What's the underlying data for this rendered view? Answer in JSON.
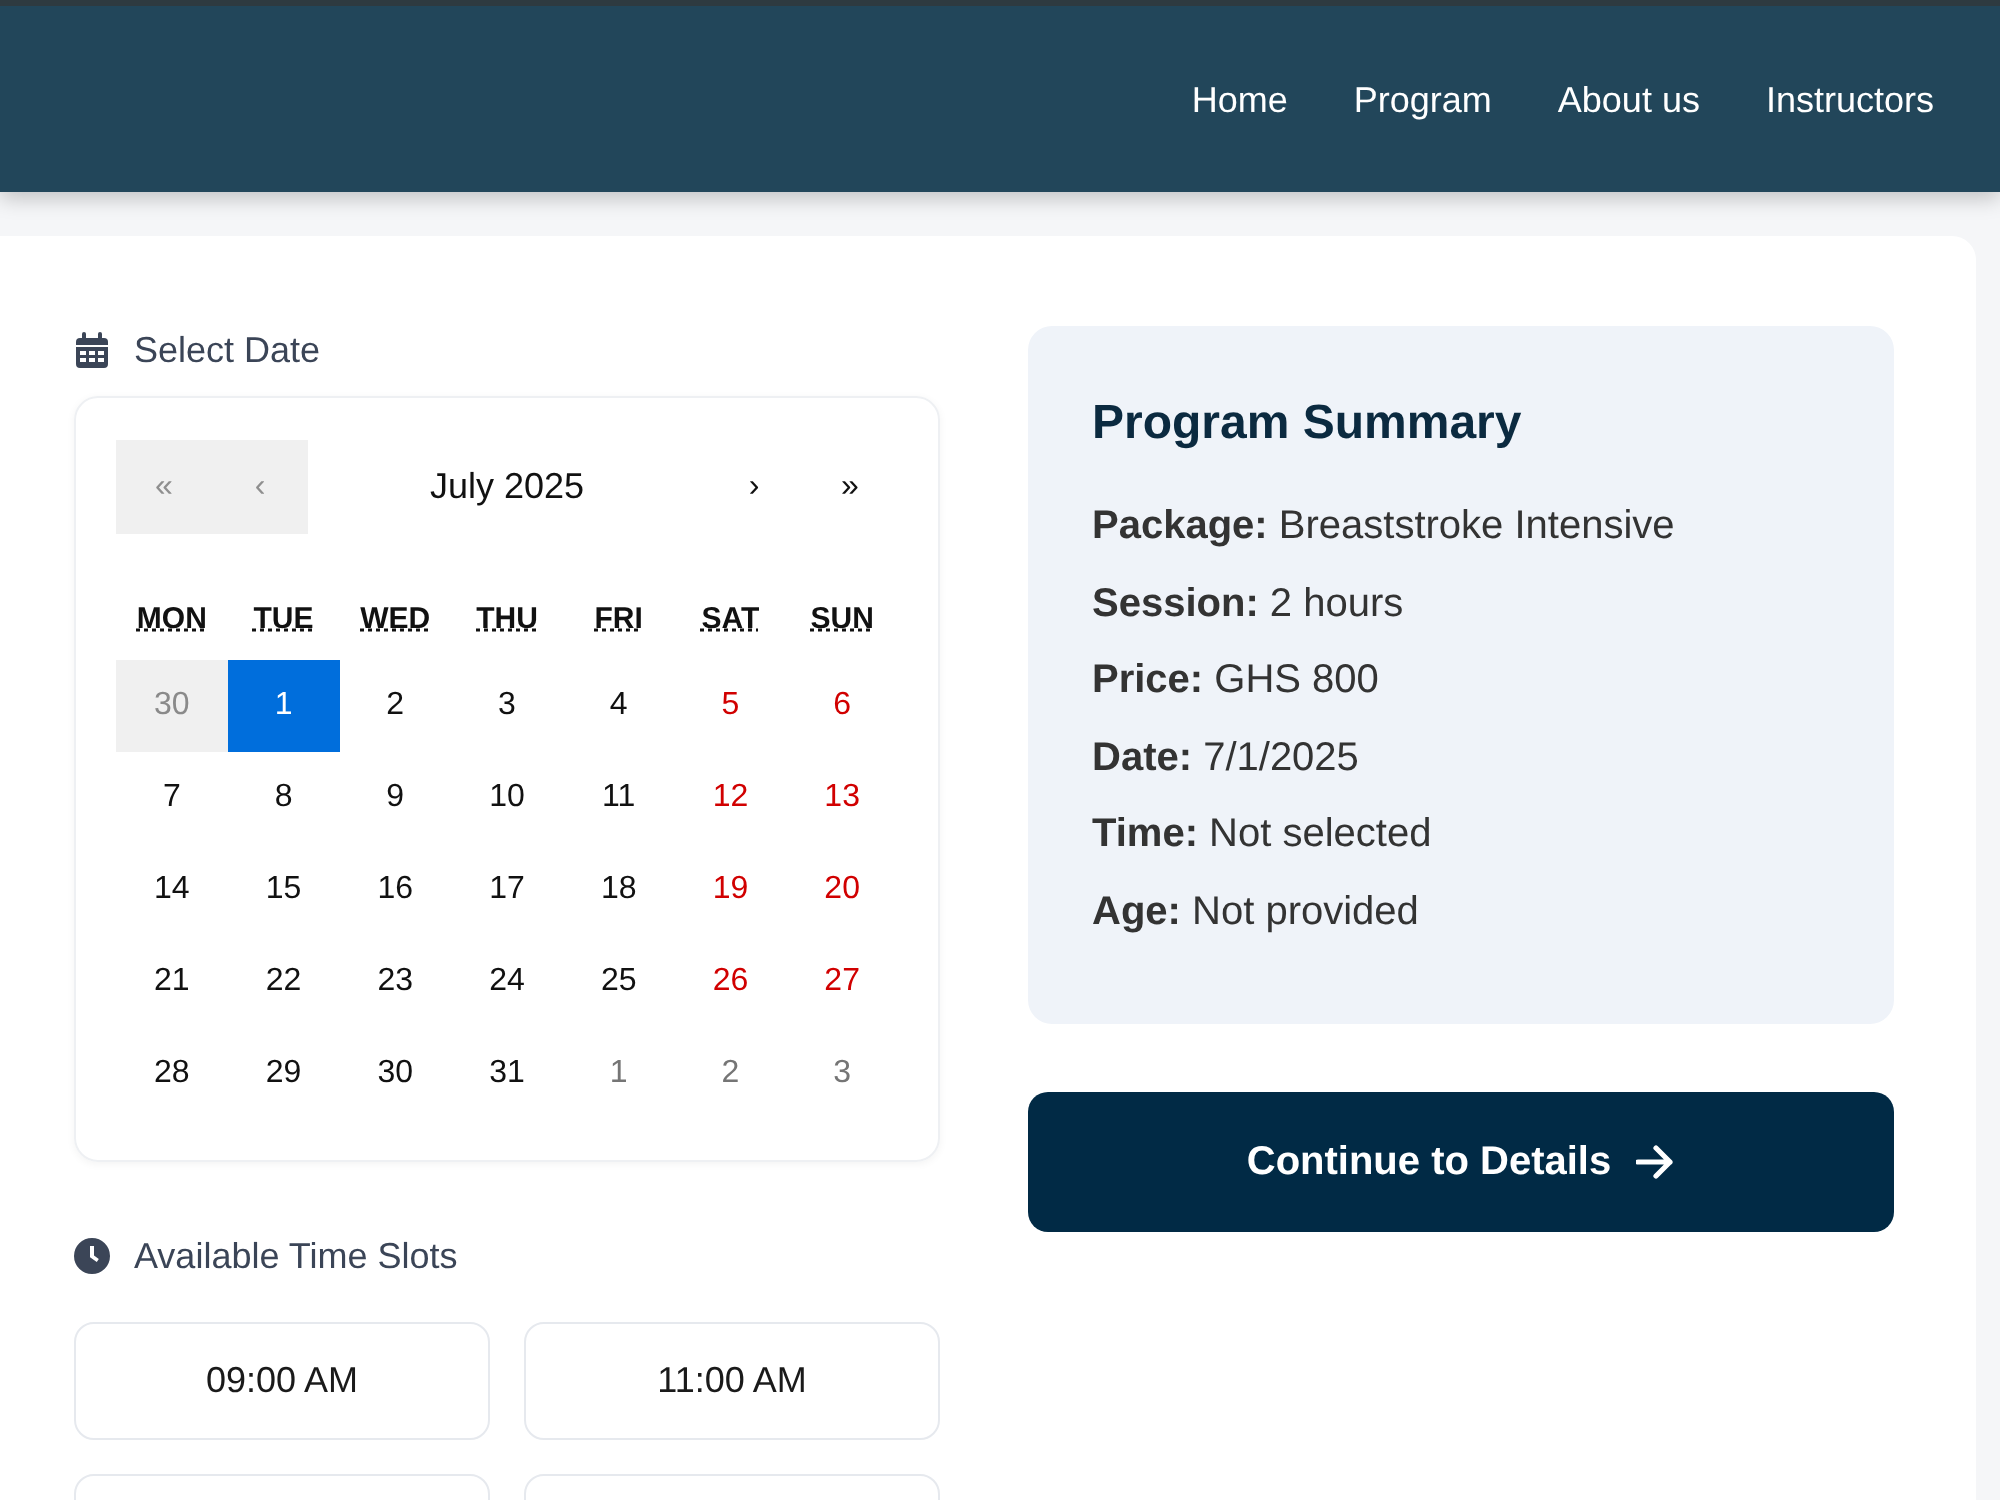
{
  "header": {
    "nav_links": [
      "Home",
      "Program",
      "About us",
      "Instructors"
    ]
  },
  "date_picker": {
    "heading": "Select Date",
    "calendar": {
      "prev_buttons": [
        {
          "label": "«",
          "disabled": true
        },
        {
          "label": "‹",
          "disabled": true
        }
      ],
      "month_label": "July 2025",
      "next_buttons": [
        {
          "label": "›",
          "disabled": false
        },
        {
          "label": "»",
          "disabled": false
        }
      ],
      "weekdays": [
        "MON",
        "TUE",
        "WED",
        "THU",
        "FRI",
        "SAT",
        "SUN"
      ],
      "weeks": [
        {
          "days": [
            {
              "label": "30",
              "kind": "disabled",
              "selected": false
            },
            {
              "label": "1",
              "kind": "day",
              "selected": true
            },
            {
              "label": "2",
              "kind": "day",
              "selected": false
            },
            {
              "label": "3",
              "kind": "day",
              "selected": false
            },
            {
              "label": "4",
              "kind": "day",
              "selected": false
            },
            {
              "label": "5",
              "kind": "weekend",
              "selected": false
            },
            {
              "label": "6",
              "kind": "weekend",
              "selected": false
            }
          ]
        },
        {
          "days": [
            {
              "label": "7",
              "kind": "day",
              "selected": false
            },
            {
              "label": "8",
              "kind": "day",
              "selected": false
            },
            {
              "label": "9",
              "kind": "day",
              "selected": false
            },
            {
              "label": "10",
              "kind": "day",
              "selected": false
            },
            {
              "label": "11",
              "kind": "day",
              "selected": false
            },
            {
              "label": "12",
              "kind": "weekend",
              "selected": false
            },
            {
              "label": "13",
              "kind": "weekend",
              "selected": false
            }
          ]
        },
        {
          "days": [
            {
              "label": "14",
              "kind": "day",
              "selected": false
            },
            {
              "label": "15",
              "kind": "day",
              "selected": false
            },
            {
              "label": "16",
              "kind": "day",
              "selected": false
            },
            {
              "label": "17",
              "kind": "day",
              "selected": false
            },
            {
              "label": "18",
              "kind": "day",
              "selected": false
            },
            {
              "label": "19",
              "kind": "weekend",
              "selected": false
            },
            {
              "label": "20",
              "kind": "weekend",
              "selected": false
            }
          ]
        },
        {
          "days": [
            {
              "label": "21",
              "kind": "day",
              "selected": false
            },
            {
              "label": "22",
              "kind": "day",
              "selected": false
            },
            {
              "label": "23",
              "kind": "day",
              "selected": false
            },
            {
              "label": "24",
              "kind": "day",
              "selected": false
            },
            {
              "label": "25",
              "kind": "day",
              "selected": false
            },
            {
              "label": "26",
              "kind": "weekend",
              "selected": false
            },
            {
              "label": "27",
              "kind": "weekend",
              "selected": false
            }
          ]
        },
        {
          "days": [
            {
              "label": "28",
              "kind": "day",
              "selected": false
            },
            {
              "label": "29",
              "kind": "day",
              "selected": false
            },
            {
              "label": "30",
              "kind": "day",
              "selected": false
            },
            {
              "label": "31",
              "kind": "day",
              "selected": false
            },
            {
              "label": "1",
              "kind": "neighbor",
              "selected": false
            },
            {
              "label": "2",
              "kind": "neighbor",
              "selected": false
            },
            {
              "label": "3",
              "kind": "neighbor",
              "selected": false
            }
          ]
        }
      ]
    }
  },
  "time_slots": {
    "heading": "Available Time Slots",
    "slots": [
      {
        "label": "09:00 AM",
        "selected": false
      },
      {
        "label": "11:00 AM",
        "selected": false
      },
      {
        "selected": false
      },
      {
        "selected": false
      }
    ]
  },
  "summary": {
    "title": "Program Summary",
    "rows": [
      {
        "label": "Package:",
        "value": "Breaststroke Intensive"
      },
      {
        "label": "Session:",
        "value": "2 hours"
      },
      {
        "label": "Price:",
        "value": "GHS 800"
      },
      {
        "label": "Date:",
        "value": "7/1/2025"
      },
      {
        "label": "Time:",
        "value": "Not selected"
      },
      {
        "label": "Age:",
        "value": "Not provided"
      }
    ]
  },
  "continue_button": {
    "label": "Continue to Details"
  }
}
